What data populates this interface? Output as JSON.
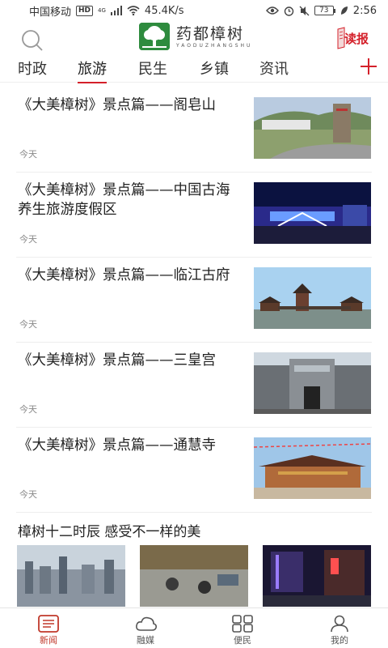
{
  "status": {
    "carrier": "中国移动",
    "hd": "HD",
    "net": "4G",
    "speed": "45.4K/s",
    "battery": "73",
    "time": "2:56"
  },
  "header": {
    "logo_name": "药都樟树",
    "logo_pinyin": "YAODUZHANGSHU",
    "read_label": "读报"
  },
  "tabs": [
    {
      "label": "时政"
    },
    {
      "label": "旅游"
    },
    {
      "label": "民生"
    },
    {
      "label": "乡镇"
    },
    {
      "label": "资讯"
    }
  ],
  "active_tab": "旅游",
  "articles": [
    {
      "title": "《大美樟树》景点篇——阁皂山",
      "time": "今天"
    },
    {
      "title": "《大美樟树》景点篇——中国古海养生旅游度假区",
      "time": "今天"
    },
    {
      "title": "《大美樟树》景点篇——临江古府",
      "time": "今天"
    },
    {
      "title": "《大美樟树》景点篇——三皇宫",
      "time": "今天"
    },
    {
      "title": "《大美樟树》景点篇——通慧寺",
      "time": "今天"
    }
  ],
  "gallery_title": "樟树十二时辰 感受不一样的美",
  "bottom_nav": [
    {
      "label": "新闻"
    },
    {
      "label": "融媒"
    },
    {
      "label": "便民"
    },
    {
      "label": "我的"
    }
  ],
  "colors": {
    "accent": "#d4202a",
    "brand_green": "#2e8b3e"
  }
}
